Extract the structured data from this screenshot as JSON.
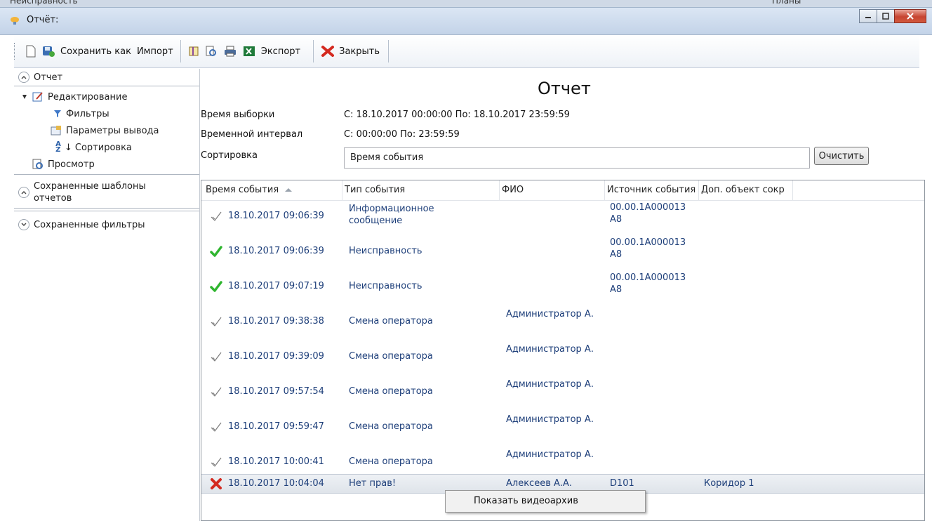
{
  "background_title": "Неисправность",
  "background_right": "Планы",
  "window": {
    "title": "Отчёт:"
  },
  "toolbar": {
    "save_as": "Сохранить как",
    "import": "Импорт",
    "export": "Экспорт",
    "close": "Закрыть"
  },
  "left": {
    "report_section": "Отчет",
    "editing": "Редактирование",
    "filters": "Фильтры",
    "output_params": "Параметры вывода",
    "sorting": "Сортировка",
    "preview": "Просмотр",
    "saved_templates": "Сохраненные шаблоны отчетов",
    "saved_filters": "Сохраненные фильтры"
  },
  "report": {
    "title": "Отчет",
    "fields": [
      {
        "label": "Время выборки",
        "value": "С: 18.10.2017 00:00:00   По: 18.10.2017 23:59:59"
      },
      {
        "label": "Временной интервал",
        "value": "С: 00:00:00 По: 23:59:59"
      }
    ],
    "sort_label": "Сортировка",
    "sort_value": "Время события",
    "clear_button": "Очистить"
  },
  "grid": {
    "columns": [
      "Время события",
      "Тип события",
      "ФИО",
      "Источник события",
      "Доп. объект сокр"
    ],
    "rows": [
      {
        "status": "ok-gray",
        "time": "18.10.2017 09:06:39",
        "type": "Информационное сообщение",
        "fio": "",
        "src": "00.00.1A000013A8",
        "obj": ""
      },
      {
        "status": "ok-green",
        "time": "18.10.2017 09:06:39",
        "type": "Неисправность",
        "fio": "",
        "src": "00.00.1A000013A8",
        "obj": ""
      },
      {
        "status": "ok-green",
        "time": "18.10.2017 09:07:19",
        "type": "Неисправность",
        "fio": "",
        "src": "00.00.1A000013A8",
        "obj": ""
      },
      {
        "status": "ok-gray",
        "time": "18.10.2017 09:38:38",
        "type": "Смена оператора",
        "fio": "Администратор А.",
        "src": "",
        "obj": ""
      },
      {
        "status": "ok-gray",
        "time": "18.10.2017 09:39:09",
        "type": "Смена оператора",
        "fio": "Администратор А.",
        "src": "",
        "obj": ""
      },
      {
        "status": "ok-gray",
        "time": "18.10.2017 09:57:54",
        "type": "Смена оператора",
        "fio": "Администратор А.",
        "src": "",
        "obj": ""
      },
      {
        "status": "ok-gray",
        "time": "18.10.2017 09:59:47",
        "type": "Смена оператора",
        "fio": "Администратор А.",
        "src": "",
        "obj": ""
      },
      {
        "status": "ok-gray",
        "time": "18.10.2017 10:00:41",
        "type": "Смена оператора",
        "fio": "Администратор А.",
        "src": "",
        "obj": ""
      },
      {
        "status": "error-red",
        "time": "18.10.2017 10:04:04",
        "type": "Нет прав!",
        "fio": "Алексеев А.А.",
        "src": "D101",
        "obj": "Коридор 1"
      }
    ]
  },
  "context_menu": {
    "item": "Показать видеоархив"
  },
  "icons": {
    "ok_green": "#2fb52f",
    "ok_gray": "#7a7a7a",
    "error_red": "#d42a20"
  }
}
